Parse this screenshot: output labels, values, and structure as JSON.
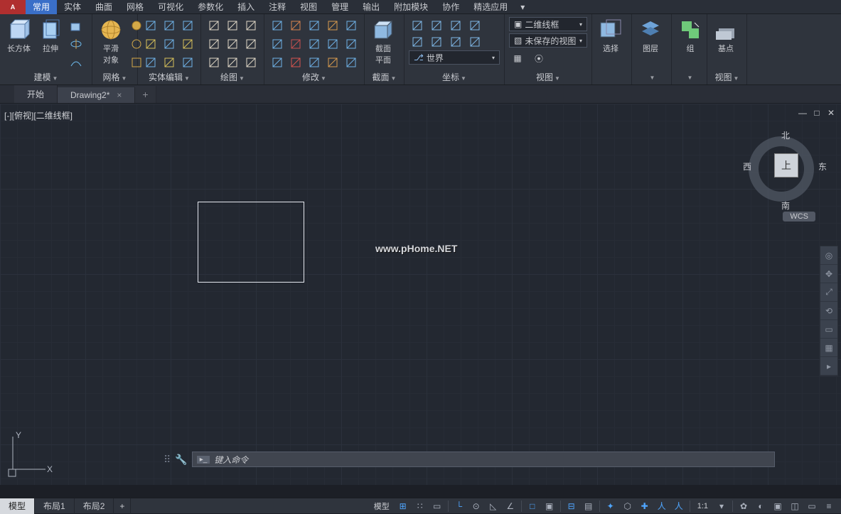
{
  "menu": {
    "items": [
      "常用",
      "实体",
      "曲面",
      "网格",
      "可视化",
      "参数化",
      "插入",
      "注释",
      "视图",
      "管理",
      "输出",
      "附加模块",
      "协作",
      "精选应用"
    ],
    "active": 0,
    "overflow": "▾"
  },
  "ribbon": {
    "modeling": {
      "box": "长方体",
      "extrude": "拉伸",
      "smooth": "平滑\n对象",
      "title": "建模",
      "meshTitle": "网格",
      "solidEdit": "实体编辑"
    },
    "draw": {
      "title": "绘图"
    },
    "modify": {
      "title": "修改"
    },
    "section": {
      "btn": "截面\n平面",
      "title": "截面"
    },
    "coord": {
      "world": "世界",
      "title": "坐标"
    },
    "view": {
      "style": "二维线框",
      "unsaved": "未保存的视图",
      "title": "视图"
    },
    "select": {
      "btn": "选择"
    },
    "layer": {
      "btn": "图层"
    },
    "group": {
      "btn": "组"
    },
    "base": {
      "btn": "基点",
      "title": "视图"
    }
  },
  "tabs": {
    "start": "开始",
    "drawing": "Drawing2*"
  },
  "canvas": {
    "viewLabel": "[-][俯视][二维线框]",
    "watermark": "www.pHome.NET",
    "wcs": "WCS",
    "dir": {
      "n": "北",
      "s": "南",
      "e": "东",
      "w": "西",
      "top": "上"
    }
  },
  "cmd": {
    "placeholder": "键入命令"
  },
  "status": {
    "model": "模型",
    "layout1": "布局1",
    "layout2": "布局2",
    "modelRight": "模型",
    "scale": "1:1",
    "gear": "✿",
    "menu": "≡"
  }
}
